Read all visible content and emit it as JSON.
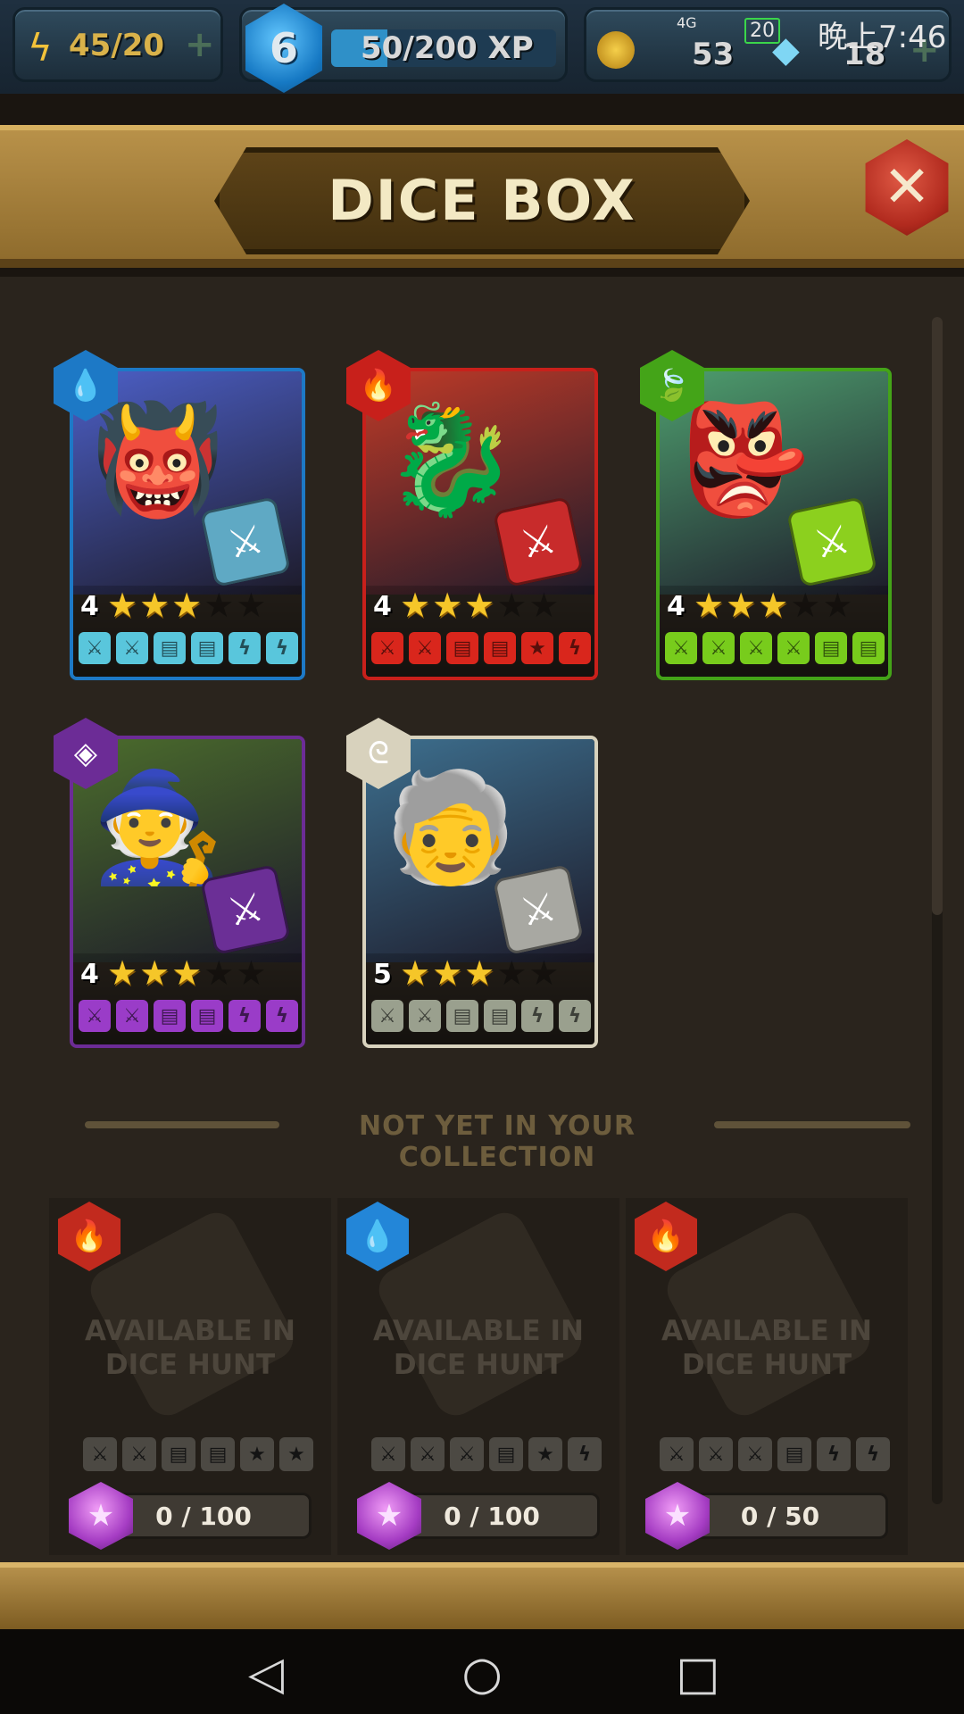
{
  "hud": {
    "energy": "45/20",
    "level": "6",
    "xp": "50/200 XP",
    "xp_fill": 0.25,
    "coins": "53",
    "gems": "18",
    "clock": "晚上7:46",
    "battery": "20",
    "network": "4G"
  },
  "title": "DICE BOX",
  "owned_cards": [
    {
      "level": "4",
      "stars": 3,
      "max_stars": 5,
      "element": "water",
      "elem_glyph": "💧",
      "border": "#1d79c6",
      "art_bg": "#4c5fc6",
      "face_color": "#59c6dc",
      "faces": [
        "⚔",
        "⚔",
        "▤",
        "▤",
        "ϟ",
        "ϟ"
      ],
      "creature": "👹",
      "die_glyph": "⚔",
      "die_color": "#5fa9c4"
    },
    {
      "level": "4",
      "stars": 3,
      "max_stars": 5,
      "element": "fire",
      "elem_glyph": "🔥",
      "border": "#c8201b",
      "art_bg": "#c03a28",
      "face_color": "#d9261c",
      "faces": [
        "⚔",
        "⚔",
        "▤",
        "▤",
        "★",
        "ϟ"
      ],
      "creature": "🐉",
      "die_glyph": "⚔",
      "die_color": "#c82b2b"
    },
    {
      "level": "4",
      "stars": 3,
      "max_stars": 5,
      "element": "nature",
      "elem_glyph": "🍃",
      "border": "#44a418",
      "art_bg": "#4e9e6e",
      "face_color": "#78cc1c",
      "faces": [
        "⚔",
        "⚔",
        "⚔",
        "⚔",
        "▤",
        "▤"
      ],
      "creature": "👺",
      "die_glyph": "⚔",
      "die_color": "#8cd01e"
    },
    {
      "level": "4",
      "stars": 3,
      "max_stars": 5,
      "element": "dark",
      "elem_glyph": "◈",
      "border": "#6c2c96",
      "art_bg": "#4b6c2c",
      "face_color": "#9a3cc8",
      "faces": [
        "⚔",
        "⚔",
        "▤",
        "▤",
        "ϟ",
        "ϟ"
      ],
      "creature": "🧙",
      "die_glyph": "⚔",
      "die_color": "#6b2f96"
    },
    {
      "level": "5",
      "stars": 3,
      "max_stars": 5,
      "element": "air",
      "elem_glyph": "ᘓ",
      "border": "#d8d2bd",
      "art_bg": "#3d6f8e",
      "face_color": "#9aa08e",
      "faces": [
        "⚔",
        "⚔",
        "▤",
        "▤",
        "ϟ",
        "ϟ"
      ],
      "creature": "🧓",
      "die_glyph": "⚔",
      "die_color": "#a8a8a2"
    }
  ],
  "divider_text": "NOT YET IN YOUR COLLECTION",
  "locked_cards": [
    {
      "element": "fire",
      "elem_glyph": "🔥",
      "elem_color": "#c22a1e",
      "label": "AVAILABLE IN DICE HUNT",
      "faces": [
        "⚔",
        "⚔",
        "▤",
        "▤",
        "★",
        "★"
      ],
      "progress": "0 / 100"
    },
    {
      "element": "water",
      "elem_glyph": "💧",
      "elem_color": "#2386d8",
      "label": "AVAILABLE IN DICE HUNT",
      "faces": [
        "⚔",
        "⚔",
        "⚔",
        "▤",
        "★",
        "ϟ"
      ],
      "progress": "0 / 100"
    },
    {
      "element": "fire",
      "elem_glyph": "🔥",
      "elem_color": "#c22a1e",
      "label": "AVAILABLE IN DICE HUNT",
      "faces": [
        "⚔",
        "⚔",
        "⚔",
        "▤",
        "ϟ",
        "ϟ"
      ],
      "progress": "0 / 50"
    }
  ],
  "nav": {
    "back": "◁",
    "home": "○",
    "recent": "□"
  }
}
